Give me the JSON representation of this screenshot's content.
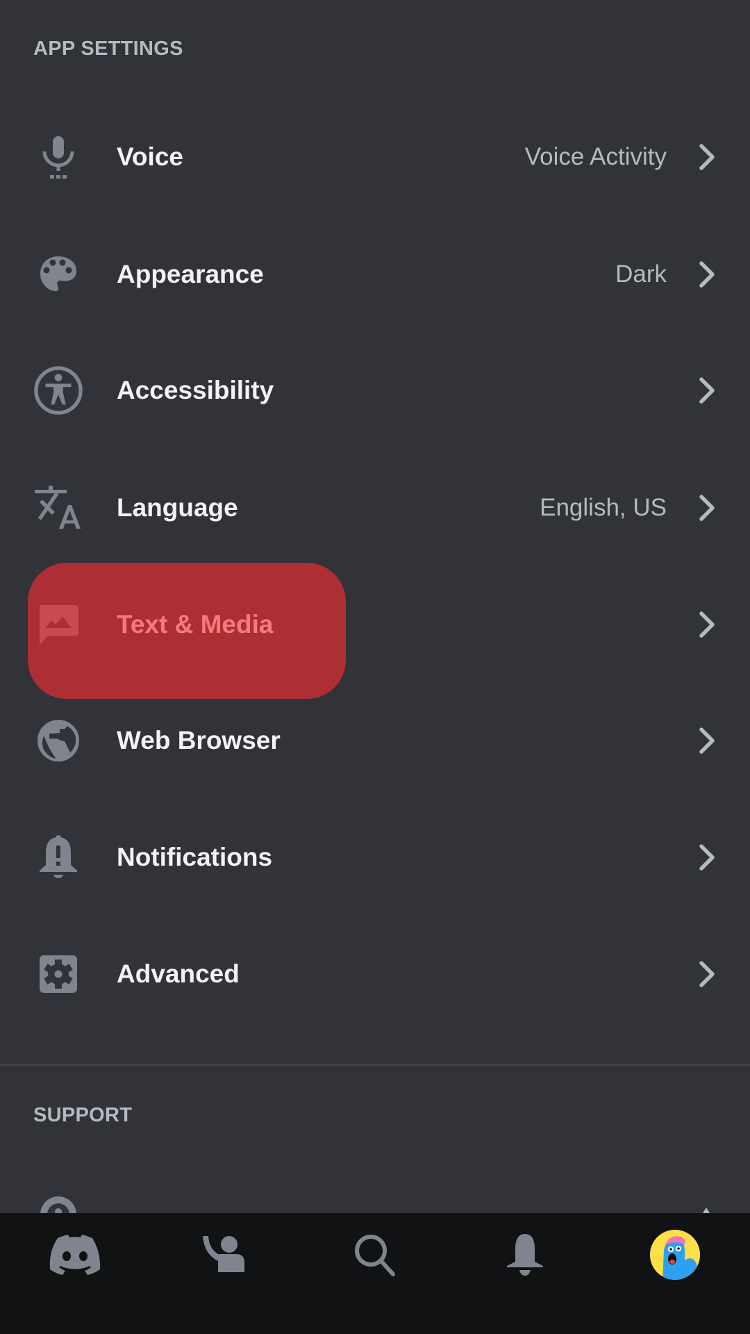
{
  "sections": {
    "app_settings": "APP SETTINGS",
    "support": "SUPPORT"
  },
  "items": [
    {
      "id": "voice",
      "label": "Voice",
      "value": "Voice Activity",
      "icon": "microphone-icon"
    },
    {
      "id": "appearance",
      "label": "Appearance",
      "value": "Dark",
      "icon": "palette-icon"
    },
    {
      "id": "accessibility",
      "label": "Accessibility",
      "value": "",
      "icon": "accessibility-icon"
    },
    {
      "id": "language",
      "label": "Language",
      "value": "English, US",
      "icon": "translate-icon"
    },
    {
      "id": "text-media",
      "label": "Text & Media",
      "value": "",
      "icon": "image-chat-icon",
      "active": true
    },
    {
      "id": "web-browser",
      "label": "Web Browser",
      "value": "",
      "icon": "globe-icon"
    },
    {
      "id": "notifications",
      "label": "Notifications",
      "value": "",
      "icon": "bell-alert-icon"
    },
    {
      "id": "advanced",
      "label": "Advanced",
      "value": "",
      "icon": "gear-icon"
    }
  ],
  "tabbar": [
    {
      "id": "home",
      "icon": "discord-logo-icon"
    },
    {
      "id": "friends",
      "icon": "friends-wave-icon"
    },
    {
      "id": "search",
      "icon": "search-icon"
    },
    {
      "id": "notifications",
      "icon": "bell-icon"
    },
    {
      "id": "profile",
      "icon": "avatar"
    }
  ],
  "colors": {
    "background": "#313338",
    "tabbar": "#111214",
    "highlight": "#ad2f33",
    "highlight_text": "#f27b7d",
    "label": "#f2f3f5",
    "muted": "#b5bac1",
    "icon": "#80848e"
  }
}
